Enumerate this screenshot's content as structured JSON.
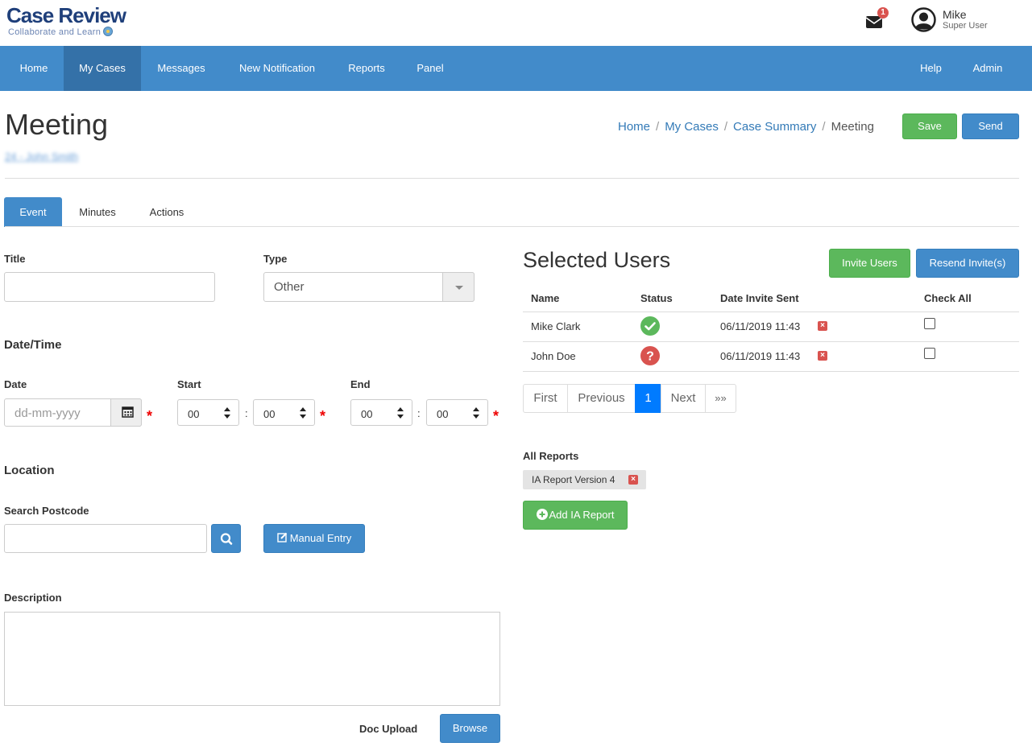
{
  "header": {
    "logo_title": "Case Review",
    "logo_subtitle": "Collaborate and Learn",
    "mail_badge": "1",
    "user_name": "Mike",
    "user_role": "Super User"
  },
  "nav": {
    "items": [
      "Home",
      "My Cases",
      "Messages",
      "New Notification",
      "Reports",
      "Panel"
    ],
    "active": "My Cases",
    "right_items": [
      "Help",
      "Admin"
    ]
  },
  "page": {
    "title": "Meeting",
    "case_link": "24 - John Smith",
    "breadcrumb": [
      "Home",
      "My Cases",
      "Case Summary",
      "Meeting"
    ],
    "save_label": "Save",
    "send_label": "Send"
  },
  "tabs": [
    "Event",
    "Minutes",
    "Actions"
  ],
  "form": {
    "title_label": "Title",
    "title_value": "",
    "type_label": "Type",
    "type_value": "Other",
    "datetime_section": "Date/Time",
    "date_label": "Date",
    "date_placeholder": "dd-mm-yyyy",
    "start_label": "Start",
    "start_hour": "00",
    "start_min": "00",
    "end_label": "End",
    "end_hour": "00",
    "end_min": "00",
    "time_separator": ":",
    "required_mark": "*",
    "location_section": "Location",
    "postcode_label": "Search Postcode",
    "manual_entry_label": "Manual Entry",
    "description_label": "Description",
    "doc_upload_label": "Doc Upload",
    "browse_label": "Browse"
  },
  "selected_users": {
    "title": "Selected Users",
    "invite_label": "Invite Users",
    "resend_label": "Resend Invite(s)",
    "columns": [
      "Name",
      "Status",
      "Date Invite Sent",
      "Check All"
    ],
    "rows": [
      {
        "name": "Mike Clark",
        "status": "accepted",
        "date": "06/11/2019 11:43"
      },
      {
        "name": "John Doe",
        "status": "unknown",
        "date": "06/11/2019 11:43"
      }
    ],
    "pagination": [
      "First",
      "Previous",
      "1",
      "Next",
      "»»"
    ]
  },
  "reports": {
    "label": "All Reports",
    "items": [
      "IA Report Version 4"
    ],
    "add_label": "Add IA Report"
  },
  "colors": {
    "primary": "#428bca",
    "success": "#5cb85c",
    "danger": "#d9534f",
    "nav_active": "#3471a8"
  }
}
